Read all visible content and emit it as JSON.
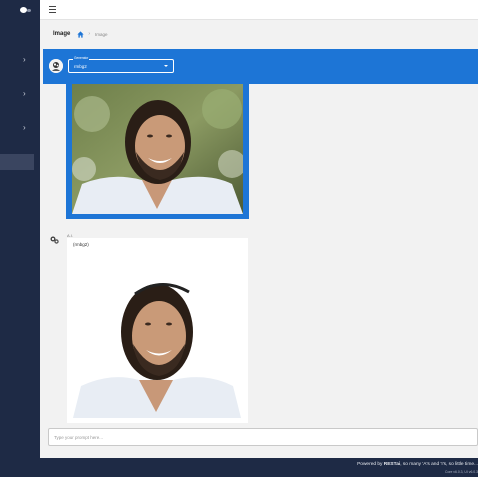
{
  "breadcrumb": {
    "title": "Image",
    "current": "Image"
  },
  "header": {
    "generator_label": "Generator",
    "generator_value": "rmbg2"
  },
  "chat": {
    "ai_name": "A.I.",
    "ai_text": "(rmbg2)"
  },
  "prompt": {
    "placeholder": "Type your prompt here..."
  },
  "footer": {
    "powered_prefix": "Powered by ",
    "brand": "RESTai",
    "powered_suffix": ", so many 'A's and 'I's, so little time...",
    "version": "Core v6.0.3, UI v6.0.3"
  },
  "icons": {
    "menu": "hamburger-icon",
    "home": "home-icon",
    "dropdown": "caret-down-icon",
    "expand": "chevron-right-icon"
  },
  "colors": {
    "sidebar": "#1e2a45",
    "accent": "#1d75d6",
    "background": "#f2f2f2"
  }
}
